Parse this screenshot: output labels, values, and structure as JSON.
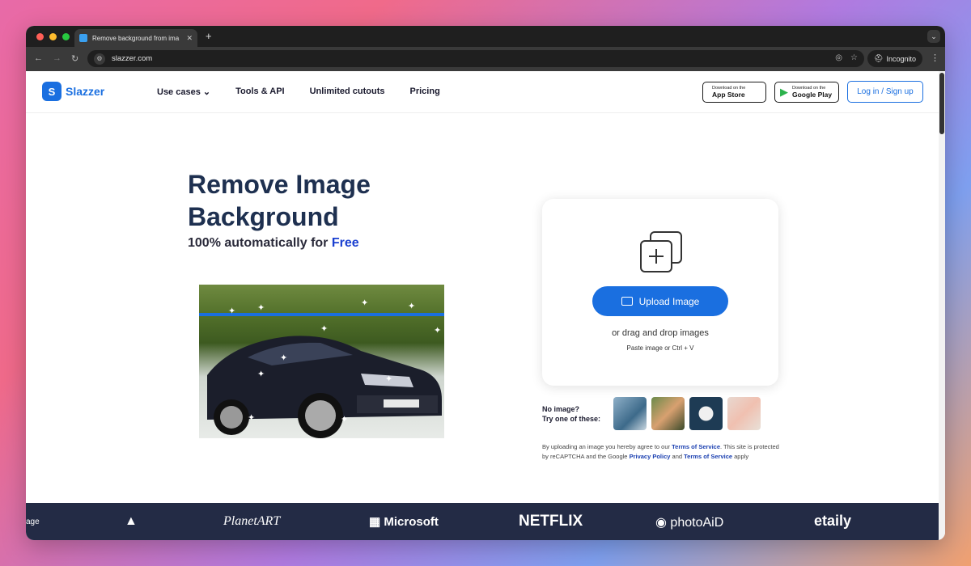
{
  "browser": {
    "tab_title": "Remove background from ima",
    "tab_close": "✕",
    "new_tab": "+",
    "url": "slazzer.com",
    "incognito_label": "Incognito"
  },
  "nav": {
    "brand": "Slazzer",
    "links": [
      "Use cases ⌄",
      "Tools & API",
      "Unlimited cutouts",
      "Pricing"
    ],
    "app_store_small": "Download on the",
    "app_store_big": "App Store",
    "google_play_small": "Download on the",
    "google_play_big": "Google Play",
    "login": "Log in / Sign up"
  },
  "hero": {
    "title_line1": "Remove Image",
    "title_line2": "Background",
    "subtitle": "100% automatically for",
    "subtitle_free": "Free"
  },
  "upload": {
    "button": "Upload Image",
    "drag_text": "or drag and drop images",
    "paste_text": "Paste image or Ctrl + V",
    "no_image_line1": "No image?",
    "no_image_line2": "Try one of these:"
  },
  "terms": {
    "part1": "By uploading an image you hereby agree to our",
    "tos": "Terms of Service",
    "part2": ". This site is protected by reCAPTCHA and the Google",
    "privacy": "Privacy Policy",
    "part3": "and",
    "tos2": "Terms of Service",
    "part4": "apply"
  },
  "logos": [
    "age",
    "PlanetART",
    "Microsoft",
    "NETFLIX",
    "photoAiD",
    "etaily"
  ],
  "colors": {
    "brand_blue": "#1a6fe0",
    "band_bg": "#232b45",
    "title_navy": "#1e3050"
  }
}
